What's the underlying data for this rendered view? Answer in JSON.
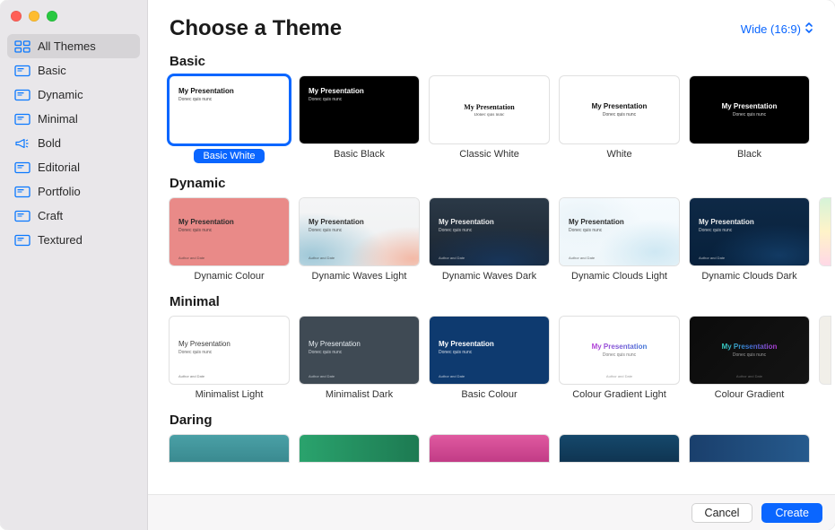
{
  "sidebar": {
    "items": [
      {
        "label": "All Themes",
        "selected": true,
        "icon": "grid"
      },
      {
        "label": "Basic",
        "selected": false,
        "icon": "slide"
      },
      {
        "label": "Dynamic",
        "selected": false,
        "icon": "slide"
      },
      {
        "label": "Minimal",
        "selected": false,
        "icon": "slide"
      },
      {
        "label": "Bold",
        "selected": false,
        "icon": "megaphone"
      },
      {
        "label": "Editorial",
        "selected": false,
        "icon": "slide"
      },
      {
        "label": "Portfolio",
        "selected": false,
        "icon": "slide"
      },
      {
        "label": "Craft",
        "selected": false,
        "icon": "slide"
      },
      {
        "label": "Textured",
        "selected": false,
        "icon": "slide"
      }
    ]
  },
  "header": {
    "title": "Choose a Theme",
    "aspect_label": "Wide (16:9)"
  },
  "thumb_text": {
    "title": "My Presentation",
    "subtitle": "Donec quis nunc",
    "footer": "Author and Date"
  },
  "sections": [
    {
      "title": "Basic",
      "themes": [
        {
          "name": "Basic White",
          "selected": true
        },
        {
          "name": "Basic Black",
          "selected": false
        },
        {
          "name": "Classic White",
          "selected": false
        },
        {
          "name": "White",
          "selected": false
        },
        {
          "name": "Black",
          "selected": false
        }
      ]
    },
    {
      "title": "Dynamic",
      "themes": [
        {
          "name": "Dynamic Colour",
          "selected": false
        },
        {
          "name": "Dynamic Waves Light",
          "selected": false
        },
        {
          "name": "Dynamic Waves Dark",
          "selected": false
        },
        {
          "name": "Dynamic Clouds Light",
          "selected": false
        },
        {
          "name": "Dynamic Clouds Dark",
          "selected": false
        }
      ]
    },
    {
      "title": "Minimal",
      "themes": [
        {
          "name": "Minimalist Light",
          "selected": false
        },
        {
          "name": "Minimalist Dark",
          "selected": false
        },
        {
          "name": "Basic Colour",
          "selected": false
        },
        {
          "name": "Colour Gradient Light",
          "selected": false
        },
        {
          "name": "Colour Gradient",
          "selected": false
        }
      ]
    },
    {
      "title": "Daring",
      "themes": []
    }
  ],
  "footer": {
    "cancel_label": "Cancel",
    "create_label": "Create"
  },
  "colors": {
    "accent": "#0a66ff"
  }
}
